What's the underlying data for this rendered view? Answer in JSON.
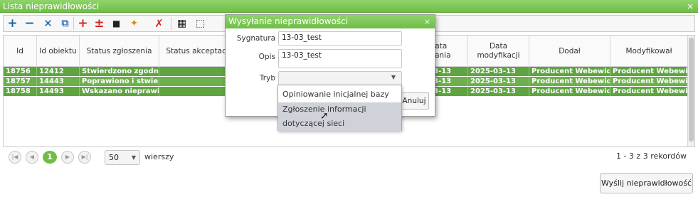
{
  "window": {
    "title": "Lista nieprawidłowości",
    "close": "×"
  },
  "toolbar": {
    "buttons": [
      {
        "name": "add",
        "glyph": "+",
        "color": "#1e63b0"
      },
      {
        "name": "remove",
        "glyph": "−",
        "color": "#1e63b0"
      },
      {
        "name": "delete",
        "glyph": "✕",
        "color": "#1e63b0"
      },
      {
        "name": "copy",
        "glyph": "⧉",
        "color": "#4d7fc4"
      },
      {
        "name": "add-red",
        "glyph": "+",
        "color": "#d12a2a"
      },
      {
        "name": "plus-minus",
        "glyph": "±",
        "color": "#d12a2a"
      },
      {
        "name": "document",
        "glyph": "■",
        "color": "#222222"
      },
      {
        "name": "pin",
        "glyph": "✦",
        "color": "#d2901f"
      },
      {
        "name": "unpin",
        "glyph": "✗",
        "color": "#d12a2a"
      },
      {
        "name": "table",
        "glyph": "▦",
        "color": "#222222"
      },
      {
        "name": "select-area",
        "glyph": "⬚",
        "color": "#333333"
      }
    ]
  },
  "grid": {
    "columns": [
      {
        "label": "Id"
      },
      {
        "label": "Id obiektu"
      },
      {
        "label": "Status zgłoszenia"
      },
      {
        "label": "Status akceptacji"
      },
      {
        "label": "Data\nodania"
      },
      {
        "label": "Data modyfikacji"
      },
      {
        "label": "Dodał"
      },
      {
        "label": "Modyfikował"
      }
    ],
    "rows": [
      {
        "id": "18756",
        "object_id": "12412",
        "status": "Stwierdzono zgodność",
        "acceptance": "",
        "date_added": "-03-13",
        "date_modified": "2025-03-13",
        "added_by": "Producent Webewid",
        "modified_by": "Producent Webewid"
      },
      {
        "id": "18757",
        "object_id": "14443",
        "status": "Poprawiono i stwierdz...",
        "acceptance": "",
        "date_added": "-03-13",
        "date_modified": "2025-03-13",
        "added_by": "Producent Webewid",
        "modified_by": "Producent Webewid"
      },
      {
        "id": "18758",
        "object_id": "14493",
        "status": "Wskazano nieprawidł...",
        "acceptance": "",
        "date_added": "-03-13",
        "date_modified": "2025-03-13",
        "added_by": "Producent Webewid",
        "modified_by": "Producent Webewid"
      }
    ]
  },
  "pager": {
    "first": "|◀",
    "prev": "◀",
    "current_page": "1",
    "next": "▶",
    "last": "▶|",
    "page_size": "50",
    "rows_label": "wierszy",
    "records": "1 - 3 z 3 rekordów"
  },
  "send_button": "Wyślij nieprawidłowość",
  "dialog": {
    "title": "Wysyłanie nieprawidłowości",
    "close": "×",
    "signature_label": "Sygnatura",
    "signature_value": "13-03_test",
    "description_label": "Opis",
    "description_value": "13-03_test",
    "mode_label": "Tryb",
    "mode_value": "",
    "cancel_label": "Anuluj"
  },
  "mode_options": [
    {
      "label": "Opiniowanie inicjalnej bazy",
      "highlighted": false
    },
    {
      "label": "Zgłoszenie informacji dotyczącej sieci",
      "highlighted": true
    }
  ],
  "colors": {
    "accent": "#6fbd47",
    "row_selected": "#5ea541"
  }
}
